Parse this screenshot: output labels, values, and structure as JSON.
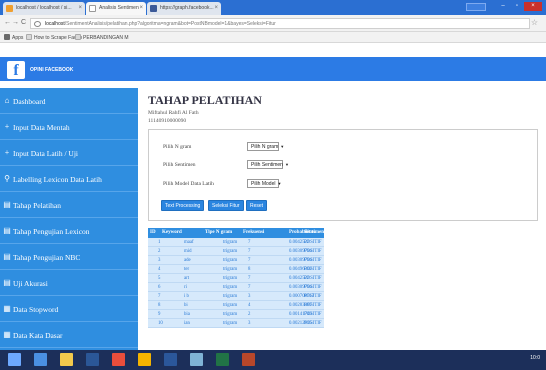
{
  "browser": {
    "tabs": [
      {
        "label": "localhost / localhost / si..."
      },
      {
        "label": "Analisis Sentimen"
      },
      {
        "label": "https://graph.facebook..."
      }
    ],
    "url_host": "localhost",
    "url_path": "/SentimentAnalisis/pelatihan.php?algoritma=ngram&bot=PostNBmodel=1&bayes=Seleksi=Fitur",
    "bookmarks": [
      {
        "label": "Apps"
      },
      {
        "label": "How to Scrape Faceb"
      },
      {
        "label": "PERBANDINGAN M"
      }
    ]
  },
  "header": {
    "logo_letter": "f",
    "brand": "OPINI FACEBOOK"
  },
  "sidebar": {
    "items": [
      {
        "label": "Dashboard",
        "icon": "home-icon",
        "glyph": "⌂"
      },
      {
        "label": "Input Data Mentah",
        "icon": "plus-icon",
        "glyph": "+"
      },
      {
        "label": "Input Data Latih / Uji",
        "icon": "plus-icon",
        "glyph": "+"
      },
      {
        "label": "Labelling Lexicon Data Latih",
        "icon": "search-icon",
        "glyph": "⚲"
      },
      {
        "label": "Tahap Pelatihan",
        "icon": "file-icon",
        "glyph": "▤"
      },
      {
        "label": "Tahap Pengujian Lexicon",
        "icon": "file-icon",
        "glyph": "▤"
      },
      {
        "label": "Tahap Pengujian NBC",
        "icon": "file-icon",
        "glyph": "▤"
      },
      {
        "label": "Uji Akurasi",
        "icon": "file-icon",
        "glyph": "▤"
      },
      {
        "label": "Data Stopword",
        "icon": "list-icon",
        "glyph": "▦"
      },
      {
        "label": "Data Kata Dasar",
        "icon": "list-icon",
        "glyph": "▦"
      }
    ]
  },
  "main": {
    "title": "TAHAP PELATIHAN",
    "author_name": "Miftahul Rahfi Al Fath",
    "author_nim": "11140910000090",
    "form": {
      "ngram_label": "Pilih N gram",
      "ngram_value": "Pilih N gram",
      "sentimen_label": "Pilih Sentimen",
      "sentimen_value": "Pilih Sentimen",
      "model_label": "Pilih Model Data Latih",
      "model_value": "Pilih Model"
    },
    "buttons": {
      "text_processing": "Text Processing",
      "seleksi_fitur": "Seleksi Fitur",
      "reset": "Reset"
    }
  },
  "table": {
    "headers": [
      "ID",
      "Keyword",
      "Tipe N gram",
      "Frekuensi",
      "Probabilitas",
      "Sentimen"
    ],
    "rows": [
      [
        "1",
        "maaf",
        "trigram",
        "7",
        "0.0042522",
        "POSITIF"
      ],
      [
        "2",
        "mid",
        "trigram",
        "7",
        "0.00309794",
        "POSITIF"
      ],
      [
        "3",
        "ade",
        "trigram",
        "7",
        "0.00309794",
        "POSITIF"
      ],
      [
        "4",
        "ter",
        "trigram",
        "8",
        "0.00496302",
        "POSITIF"
      ],
      [
        "5",
        "art",
        "trigram",
        "7",
        "0.0042522",
        "POSITIF"
      ],
      [
        "6",
        "ri",
        "trigram",
        "7",
        "0.00309794",
        "POSITIF"
      ],
      [
        "7",
        "i b",
        "trigram",
        "3",
        "0.000708717",
        "POSITIF"
      ],
      [
        "8",
        "bi",
        "trigram",
        "4",
        "0.00283487",
        "POSITIF"
      ],
      [
        "9",
        "bia",
        "trigram",
        "2",
        "0.00141743",
        "POSITIF"
      ],
      [
        "10",
        "ian",
        "trigram",
        "3",
        "0.00212615",
        "POSITIF"
      ]
    ]
  },
  "taskbar": {
    "clock": "10:0"
  },
  "colors": {
    "primary": "#2c7be5",
    "sidebar": "#2f8ee0",
    "button": "#2a85e0",
    "table_row": "#d6e9fb",
    "table_text": "#2b7bd6",
    "chrome_title": "#2b6fd2",
    "taskbar": "#1c2f5a"
  }
}
